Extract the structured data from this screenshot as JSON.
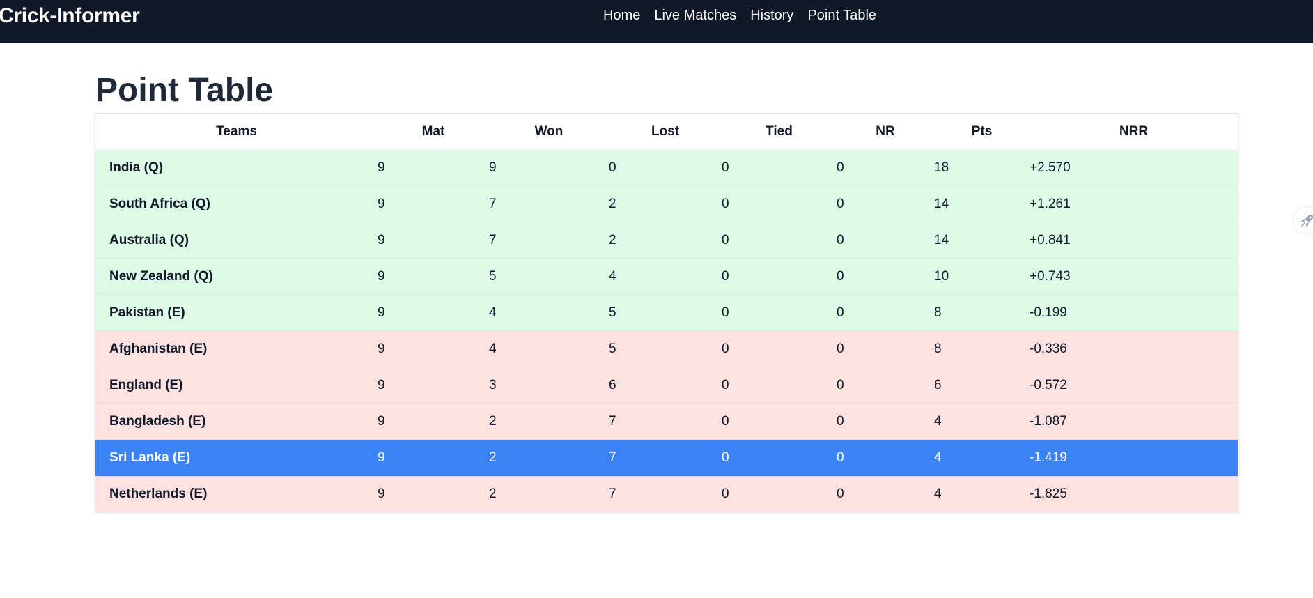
{
  "navbar": {
    "brand": "Crick-Informer",
    "links": [
      "Home",
      "Live Matches",
      "History",
      "Point Table"
    ]
  },
  "page": {
    "title": "Point Table"
  },
  "table": {
    "headers": [
      "Teams",
      "Mat",
      "Won",
      "Lost",
      "Tied",
      "NR",
      "Pts",
      "NRR"
    ],
    "rows": [
      {
        "team": "India (Q)",
        "mat": "9",
        "won": "9",
        "lost": "0",
        "tied": "0",
        "nr": "0",
        "pts": "18",
        "nrr": "+2.570",
        "status": "qualified"
      },
      {
        "team": "South Africa (Q)",
        "mat": "9",
        "won": "7",
        "lost": "2",
        "tied": "0",
        "nr": "0",
        "pts": "14",
        "nrr": "+1.261",
        "status": "qualified"
      },
      {
        "team": "Australia (Q)",
        "mat": "9",
        "won": "7",
        "lost": "2",
        "tied": "0",
        "nr": "0",
        "pts": "14",
        "nrr": "+0.841",
        "status": "qualified"
      },
      {
        "team": "New Zealand (Q)",
        "mat": "9",
        "won": "5",
        "lost": "4",
        "tied": "0",
        "nr": "0",
        "pts": "10",
        "nrr": "+0.743",
        "status": "qualified"
      },
      {
        "team": "Pakistan (E)",
        "mat": "9",
        "won": "4",
        "lost": "5",
        "tied": "0",
        "nr": "0",
        "pts": "8",
        "nrr": "-0.199",
        "status": "qualified"
      },
      {
        "team": "Afghanistan (E)",
        "mat": "9",
        "won": "4",
        "lost": "5",
        "tied": "0",
        "nr": "0",
        "pts": "8",
        "nrr": "-0.336",
        "status": "eliminated"
      },
      {
        "team": "England (E)",
        "mat": "9",
        "won": "3",
        "lost": "6",
        "tied": "0",
        "nr": "0",
        "pts": "6",
        "nrr": "-0.572",
        "status": "eliminated"
      },
      {
        "team": "Bangladesh (E)",
        "mat": "9",
        "won": "2",
        "lost": "7",
        "tied": "0",
        "nr": "0",
        "pts": "4",
        "nrr": "-1.087",
        "status": "eliminated"
      },
      {
        "team": "Sri Lanka (E)",
        "mat": "9",
        "won": "2",
        "lost": "7",
        "tied": "0",
        "nr": "0",
        "pts": "4",
        "nrr": "-1.419",
        "status": "selected"
      },
      {
        "team": "Netherlands (E)",
        "mat": "9",
        "won": "2",
        "lost": "7",
        "tied": "0",
        "nr": "0",
        "pts": "4",
        "nrr": "-1.825",
        "status": "eliminated"
      }
    ]
  },
  "colors": {
    "navbar_bg": "#111827",
    "qualified_row": "#dcfce7",
    "eliminated_row": "#fee2e2",
    "selected_row": "#3b82f6"
  },
  "icons": {
    "side_tab": "rocket-icon"
  }
}
